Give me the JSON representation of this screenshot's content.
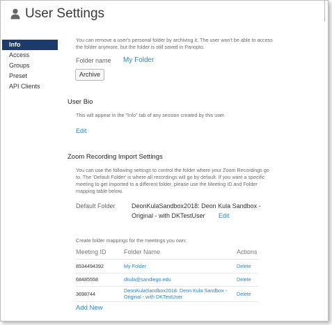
{
  "header": {
    "title": "User Settings",
    "icon": "user-icon"
  },
  "sidebar": {
    "items": [
      {
        "label": "Info",
        "active": true
      },
      {
        "label": "Access",
        "active": false
      },
      {
        "label": "Groups",
        "active": false
      },
      {
        "label": "Preset",
        "active": false
      },
      {
        "label": "API Clients",
        "active": false
      }
    ]
  },
  "folder": {
    "desc_line1": "You can remove a user's personal folder by archiving it. The user won't be able to access",
    "desc_line2": "the folder anymore, but the folder is still saved in Panopto.",
    "label": "Folder name",
    "value": "My Folder",
    "archive_button": "Archive"
  },
  "bio": {
    "title": "User Bio",
    "desc": "This will appear in the \"Info\" tab of any session created by this user.",
    "edit": "Edit"
  },
  "zoom": {
    "title": "Zoom Recording Import Settings",
    "desc_lines": [
      "You can use the following settings to control the folder where your Zoom Recordings go",
      "to. The 'Default Folder' is where all recordings will go by default. If you want a specific",
      "meeting to get imported to a different folder, please use the Meeting ID and Folder",
      "mapping table below."
    ],
    "default_label": "Default Folder",
    "default_value_line1": "DeonKulaSandbox2018: Deon Kula Sandbox -",
    "default_value_line2": "Original - with DKTestUser",
    "default_edit": "Edit",
    "mappings_intro": "Create folder mappings for the meetings you own:",
    "columns": [
      "Meeting ID",
      "Folder Name",
      "Actions"
    ],
    "rows": [
      {
        "meeting_id": "8534494392",
        "folder": "My Folder",
        "action": "Delete"
      },
      {
        "meeting_id": "68485558",
        "folder": "dkula@sandiego.edu",
        "action": "Delete"
      },
      {
        "meeting_id": "3698744",
        "folder_line1": "DeonKulaSandbox2018: Deon Kula Sandbox -",
        "folder_line2": "Original - with DKTestUser",
        "action": "Delete"
      }
    ],
    "add_new": "Add New"
  }
}
